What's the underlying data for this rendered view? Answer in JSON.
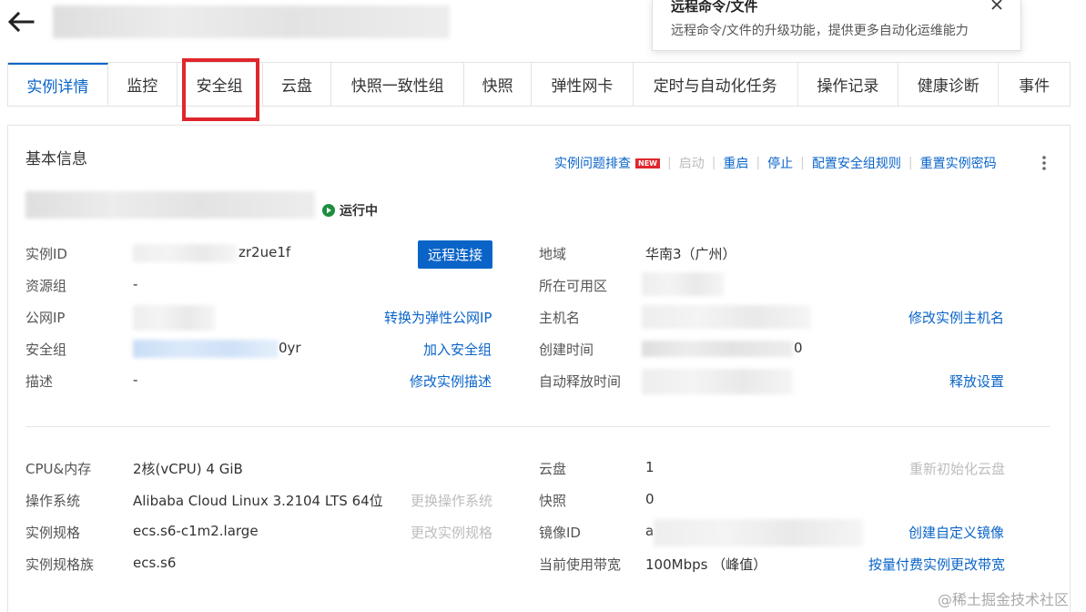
{
  "header": {
    "back_icon": "arrow-left-icon"
  },
  "tooltip": {
    "title": "远程命令/文件",
    "body": "远程命令/文件的升级功能，提供更多自动化运维能力",
    "close_icon": "close-icon"
  },
  "tabs": [
    {
      "label": "实例详情",
      "active": true
    },
    {
      "label": "监控"
    },
    {
      "label": "安全组",
      "highlighted": true
    },
    {
      "label": "云盘"
    },
    {
      "label": "快照一致性组"
    },
    {
      "label": "快照"
    },
    {
      "label": "弹性网卡"
    },
    {
      "label": "定时与自动化任务"
    },
    {
      "label": "操作记录"
    },
    {
      "label": "健康诊断"
    },
    {
      "label": "事件"
    }
  ],
  "basic": {
    "title": "基本信息",
    "actions": {
      "troubleshoot": "实例问题排查",
      "new_badge": "NEW",
      "start": "启动",
      "restart": "重启",
      "stop": "停止",
      "config_sg_rules": "配置安全组规则",
      "reset_password": "重置实例密码",
      "more_icon": "more-vertical-icon"
    },
    "status": "运行中",
    "remote_connect": "远程连接",
    "left_rows": [
      {
        "label": "实例ID",
        "value": "zr2ue1f",
        "action": ""
      },
      {
        "label": "资源组",
        "value": "-",
        "action": ""
      },
      {
        "label": "公网IP",
        "value": "",
        "action": "转换为弹性公网IP"
      },
      {
        "label": "安全组",
        "value": "0yr",
        "action": "加入安全组"
      },
      {
        "label": "描述",
        "value": "-",
        "action": "修改实例描述"
      }
    ],
    "right_rows": [
      {
        "label": "地域",
        "value": "华南3（广州）",
        "action": ""
      },
      {
        "label": "所在可用区",
        "value": "",
        "action": ""
      },
      {
        "label": "主机名",
        "value": "",
        "action": "修改实例主机名"
      },
      {
        "label": "创建时间",
        "value": "0",
        "action": ""
      },
      {
        "label": "自动释放时间",
        "value": "",
        "action": "释放设置"
      }
    ]
  },
  "config": {
    "left_rows": [
      {
        "label": "CPU&内存",
        "value": "2核(vCPU) 4 GiB",
        "action": ""
      },
      {
        "label": "操作系统",
        "value": "Alibaba Cloud Linux 3.2104 LTS 64位",
        "action": "更换操作系统"
      },
      {
        "label": "实例规格",
        "value": "ecs.s6-c1m2.large",
        "action": "更改实例规格"
      },
      {
        "label": "实例规格族",
        "value": "ecs.s6",
        "action": ""
      }
    ],
    "right_rows": [
      {
        "label": "云盘",
        "value": "1",
        "action": "重新初始化云盘"
      },
      {
        "label": "快照",
        "value": "0",
        "action": ""
      },
      {
        "label": "镜像ID",
        "value": "a",
        "action": "创建自定义镜像"
      },
      {
        "label": "当前使用带宽",
        "value": "100Mbps （峰值）",
        "action": "按量付费实例更改带宽"
      }
    ]
  },
  "watermark": "@稀土掘金技术社区",
  "colors": {
    "accent": "#0a64c8",
    "highlight_box": "#e0262d",
    "status_green": "#1e8e3e",
    "remote_btn": "#0a64c8"
  }
}
